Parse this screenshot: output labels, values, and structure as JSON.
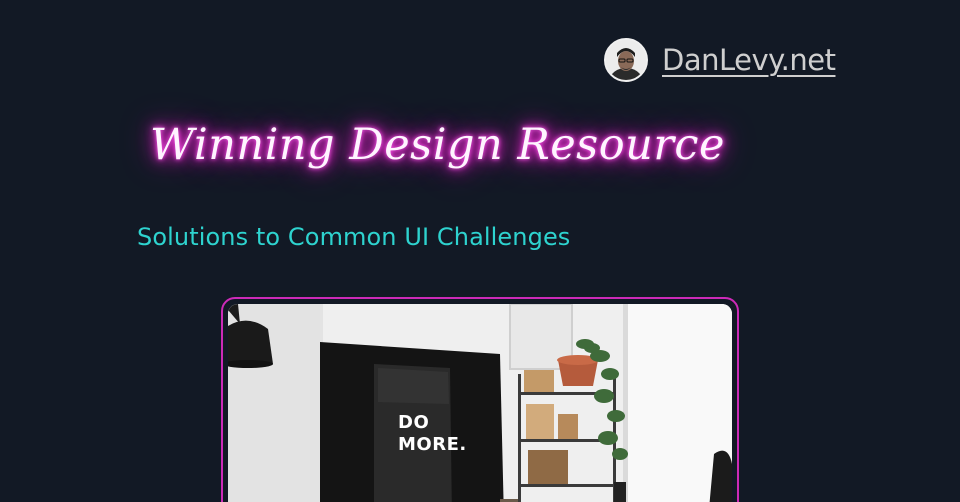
{
  "brand": {
    "name": "DanLevy.net",
    "avatar_icon": "avatar-photo"
  },
  "hero": {
    "title": "Winning Design Resource",
    "subtitle": "Solutions to Common UI Challenges"
  },
  "photo": {
    "monitor_line1": "DO",
    "monitor_line2": "MORE."
  },
  "colors": {
    "background": "#121925",
    "neon_pink": "#ff2bdc",
    "subtitle_teal": "#2ed3cf",
    "card_border": "#cc2ab8"
  }
}
